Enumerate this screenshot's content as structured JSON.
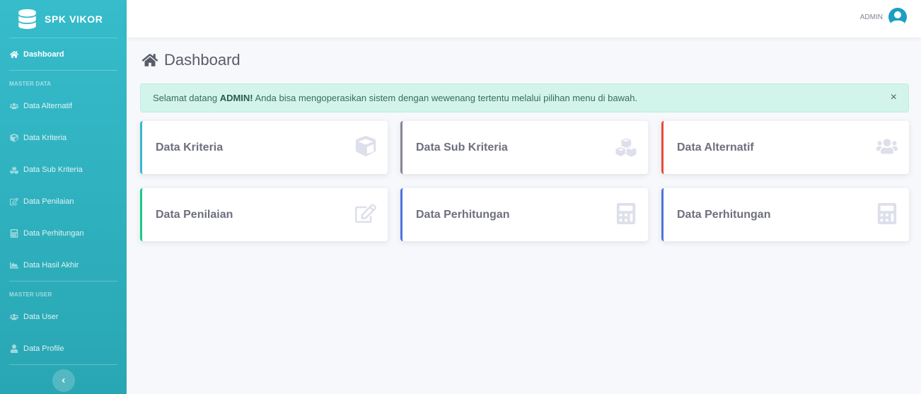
{
  "brand": {
    "title": "SPK VIKOR"
  },
  "sidebar": {
    "dashboard": "Dashboard",
    "section_master_data": "MASTER DATA",
    "items_data": [
      {
        "label": "Data Alternatif",
        "icon": "users-icon"
      },
      {
        "label": "Data Kriteria",
        "icon": "cube-icon"
      },
      {
        "label": "Data Sub Kriteria",
        "icon": "cubes-icon"
      },
      {
        "label": "Data Penilaian",
        "icon": "edit-icon"
      },
      {
        "label": "Data Perhitungan",
        "icon": "calculator-icon"
      },
      {
        "label": "Data Hasil Akhir",
        "icon": "chart-area-icon"
      }
    ],
    "section_master_user": "MASTER USER",
    "items_user": [
      {
        "label": "Data User",
        "icon": "users-icon"
      },
      {
        "label": "Data Profile",
        "icon": "user-icon"
      }
    ]
  },
  "topbar": {
    "username": "ADMIN"
  },
  "page": {
    "title": "Dashboard"
  },
  "alert": {
    "prefix": "Selamat datang ",
    "user": "ADMIN!",
    "suffix": " Anda bisa mengoperasikan sistem dengan wewenang tertentu melalui pilihan menu di bawah.",
    "close": "×"
  },
  "cards": [
    {
      "label": "Data Kriteria",
      "icon": "cube-icon",
      "accent": "#36b9cc"
    },
    {
      "label": "Data Sub Kriteria",
      "icon": "cubes-icon",
      "accent": "#858796"
    },
    {
      "label": "Data Alternatif",
      "icon": "users-icon",
      "accent": "#e74a3b"
    },
    {
      "label": "Data Penilaian",
      "icon": "edit-icon",
      "accent": "#1cc88a"
    },
    {
      "label": "Data Perhitungan",
      "icon": "calculator-icon",
      "accent": "#4e73df"
    },
    {
      "label": "Data Perhitungan",
      "icon": "calculator-icon",
      "accent": "#4e73df"
    }
  ],
  "colors": {
    "sidebar": "#36bccb",
    "alert_bg": "#d2f4ea",
    "avatar": "#1b9fc2"
  }
}
